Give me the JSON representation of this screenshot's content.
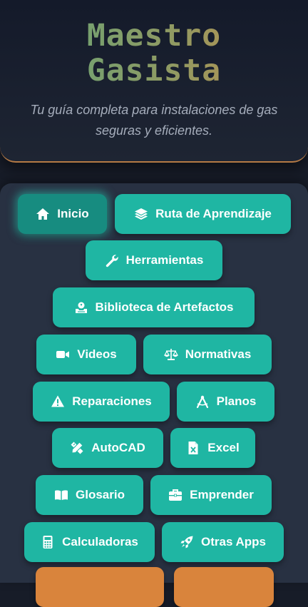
{
  "header": {
    "title_line1": "Maestro",
    "title_line2": "Gasista",
    "subtitle": "Tu guía completa para instalaciones de gas seguras y eficientes."
  },
  "menu": {
    "inicio": "Inicio",
    "ruta": "Ruta de Aprendizaje",
    "herramientas": "Herramientas",
    "biblioteca": "Biblioteca de Artefactos",
    "videos": "Videos",
    "normativas": "Normativas",
    "reparaciones": "Reparaciones",
    "planos": "Planos",
    "autocad": "AutoCAD",
    "excel": "Excel",
    "glosario": "Glosario",
    "emprender": "Emprender",
    "calculadoras": "Calculadoras",
    "otras_apps": "Otras Apps"
  },
  "icons": {
    "inicio": "home-icon",
    "ruta": "layers-icon",
    "herramientas": "wrench-icon",
    "biblioteca": "archive-icon",
    "videos": "video-camera-icon",
    "normativas": "scale-icon",
    "reparaciones": "warning-icon",
    "planos": "compass-drafting-icon",
    "autocad": "pencil-ruler-icon",
    "excel": "excel-file-icon",
    "glosario": "book-open-icon",
    "emprender": "briefcase-icon",
    "calculadoras": "calculator-icon",
    "otras_apps": "rocket-icon"
  },
  "colors": {
    "background": "#171c28",
    "panel": "#283142",
    "button": "#1fb6a3",
    "button_active": "#178c80",
    "accent_orange": "#d9843c",
    "title_green": "#5fa67b",
    "title_orange": "#c98e48"
  }
}
